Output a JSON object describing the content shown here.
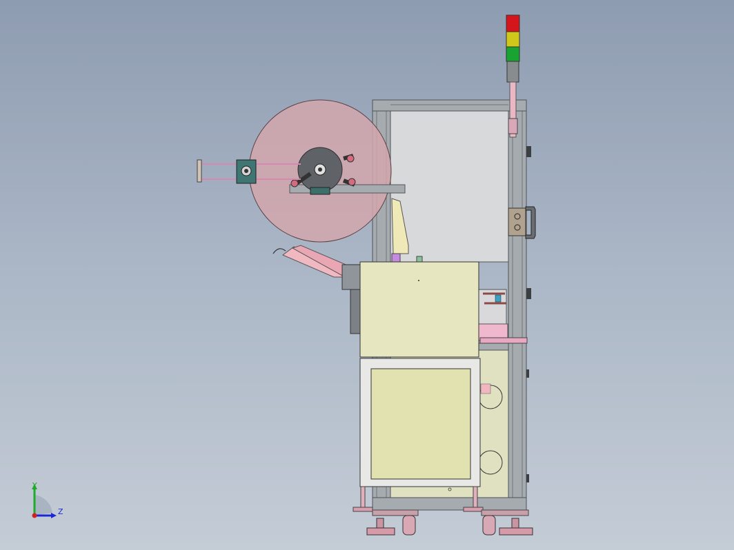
{
  "triad": {
    "y_label": "Y",
    "z_label": "Z",
    "y_color": "#1faa2a",
    "z_color": "#1b27d6",
    "origin_color": "#d62020"
  },
  "icons": [
    "signal-tower-icon",
    "tape-reel-icon",
    "door-handle-icon",
    "caster-wheel-icon",
    "axis-triad-icon"
  ],
  "colors": {
    "background_top": "#8e9cb1",
    "background_bottom": "#c4ccd6",
    "frame": "#a2a8ad",
    "panel": "#e6e6c0",
    "reel": "#d6a6ae",
    "pink_parts": "#e9b8c4",
    "light_red": "#d5151c",
    "light_yellow": "#cfc81a",
    "light_green": "#19a330"
  }
}
